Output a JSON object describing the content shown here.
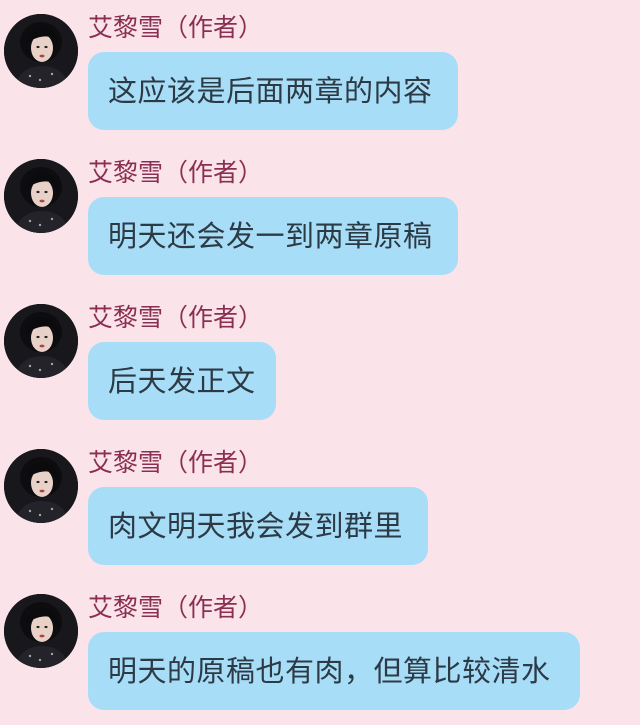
{
  "chat": {
    "messages": [
      {
        "sender": "艾黎雪（作者）",
        "text": "这应该是后面两章的内容"
      },
      {
        "sender": "艾黎雪（作者）",
        "text": "明天还会发一到两章原稿"
      },
      {
        "sender": "艾黎雪（作者）",
        "text": "后天发正文"
      },
      {
        "sender": "艾黎雪（作者）",
        "text": "肉文明天我会发到群里"
      },
      {
        "sender": "艾黎雪（作者）",
        "text": "明天的原稿也有肉，但算比较清水"
      }
    ]
  },
  "colors": {
    "background": "#fbe3ea",
    "bubble": "#a8ddf7",
    "sender_name": "#8a2f52",
    "message_text": "#2b3a45"
  },
  "icons": {
    "avatar": "user-avatar-photo"
  }
}
